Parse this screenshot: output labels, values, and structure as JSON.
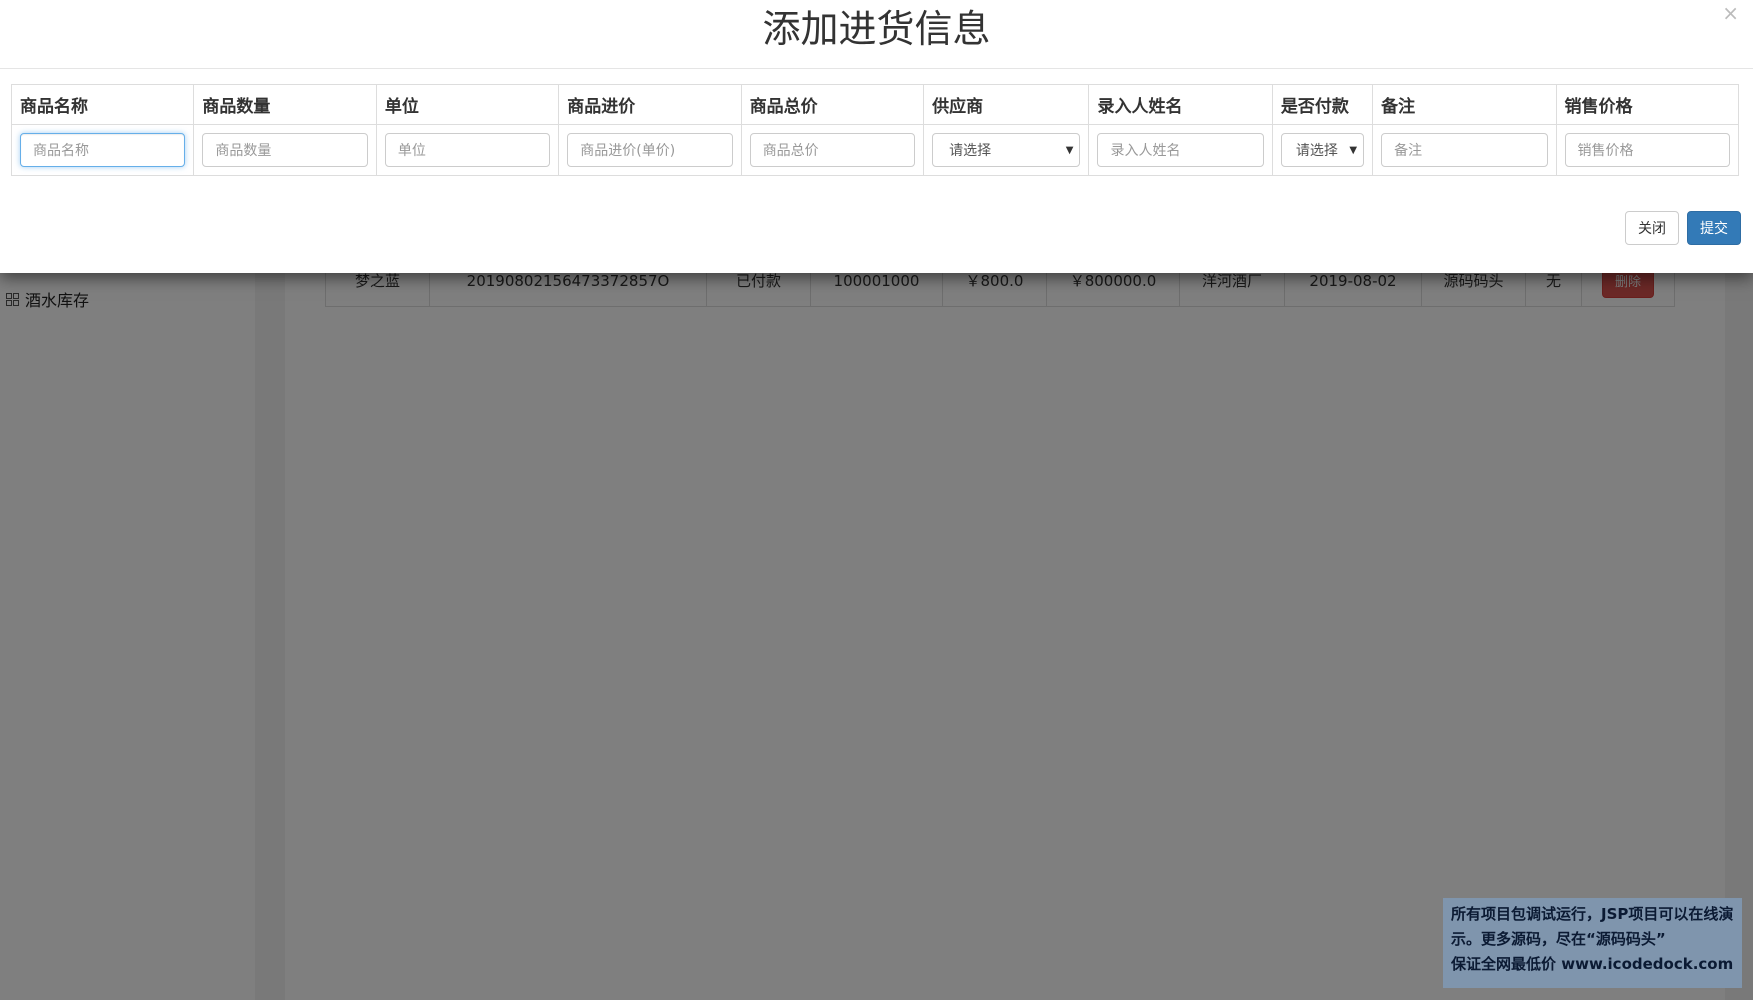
{
  "modal": {
    "title": "添加进货信息",
    "close_glyph": "×",
    "columns": [
      "商品名称",
      "商品数量",
      "单位",
      "商品进价",
      "商品总价",
      "供应商",
      "录入人姓名",
      "是否付款",
      "备注",
      "销售价格"
    ],
    "placeholders": [
      "商品名称",
      "商品数量",
      "单位",
      "商品进价(单价)",
      "商品总价",
      "请选择",
      "录入人姓名",
      "请选择",
      "备注",
      "销售价格"
    ],
    "close_button": "关闭",
    "submit_button": "提交"
  },
  "sidebar": {
    "item_label": "酒水库存",
    "item_icon": "grid-icon"
  },
  "table": {
    "row": [
      "梦之蓝",
      "20190802156473372857O",
      "已付款",
      "100001000",
      "￥800.0",
      "￥800000.0",
      "洋河酒厂",
      "2019-08-02",
      "源码码头",
      "无"
    ],
    "delete_label": "删除"
  },
  "watermark": {
    "line1": "所有项目包调试运行，JSP项目可以在线演",
    "line2": "示。更多源码，尽在“源码码头”",
    "line3": "保证全网最低价 www.icodedock.com"
  },
  "colors": {
    "primary": "#337ab7",
    "danger": "#d9534f",
    "overlay": "rgba(0,0,0,0.5)"
  }
}
